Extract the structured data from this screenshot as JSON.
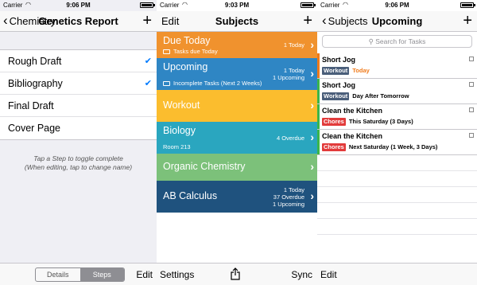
{
  "panel1": {
    "status": {
      "carrier": "Carrier",
      "time": "9:06 PM"
    },
    "back_label": "Chemistry",
    "title": "Genetics Report",
    "plus": "+",
    "steps": [
      {
        "label": "Rough Draft",
        "checked": true
      },
      {
        "label": "Bibliography",
        "checked": true
      },
      {
        "label": "Final Draft",
        "checked": false
      },
      {
        "label": "Cover Page",
        "checked": false
      }
    ],
    "check_glyph": "✔",
    "hint_line1": "Tap a Step to toggle complete",
    "hint_line2": "(When editing, tap to change name)",
    "segments": {
      "details": "Details",
      "steps": "Steps",
      "selected": "Steps"
    },
    "edit": "Edit"
  },
  "panel2": {
    "status": {
      "carrier": "Carrier",
      "time": "9:03 PM"
    },
    "edit": "Edit",
    "title": "Subjects",
    "plus": "+",
    "subjects": [
      {
        "name": "Due Today",
        "sub": "Tasks due Today",
        "meta": [
          "1 Today"
        ],
        "color": "#f0922e",
        "folder": true
      },
      {
        "name": "Upcoming",
        "sub": "Incomplete Tasks (Next 2 Weeks)",
        "meta": [
          "1 Today",
          "1 Upcoming"
        ],
        "color": "#2f86c4",
        "folder": true
      },
      {
        "name": "Workout",
        "sub": "",
        "meta": [],
        "color": "#fbbd2e",
        "folder": false
      },
      {
        "name": "Biology",
        "sub": "Room 213",
        "meta": [
          "4 Overdue"
        ],
        "color": "#2aa6bf",
        "folder": false
      },
      {
        "name": "Organic Chemistry",
        "sub": "",
        "meta": [],
        "color": "#7cc17a",
        "folder": false
      },
      {
        "name": "AB Calculus",
        "sub": "",
        "meta": [
          "1 Today",
          "37 Overdue",
          "1 Upcoming"
        ],
        "color": "#1f527e",
        "folder": false
      }
    ],
    "toolbar": {
      "settings": "Settings",
      "sync": "Sync"
    }
  },
  "panel3": {
    "status": {
      "carrier": "Carrier",
      "time": "9:06 PM"
    },
    "back_label": "Subjects",
    "title": "Upcoming",
    "plus": "+",
    "search_placeholder": "Search for Tasks",
    "tasks": [
      {
        "name": "Short Jog",
        "badge": "Workout",
        "badge_color": "#4a5e7a",
        "due": "Today",
        "due_color": "#f07a1a",
        "bar_color": "#f07a1a"
      },
      {
        "name": "Short Jog",
        "badge": "Workout",
        "badge_color": "#4a5e7a",
        "due": "Day After Tomorrow",
        "due_color": "#000000",
        "bar_color": "#3bb54a"
      },
      {
        "name": "Clean the Kitchen",
        "badge": "Chores",
        "badge_color": "#e23b3b",
        "due": "This Saturday (3 Days)",
        "due_color": "#000000",
        "bar_color": "#3bb54a"
      },
      {
        "name": "Clean the Kitchen",
        "badge": "Chores",
        "badge_color": "#e23b3b",
        "due": "Next Saturday (1 Week, 3 Days)",
        "due_color": "#000000",
        "bar_color": "#3bb54a"
      }
    ],
    "edit": "Edit"
  },
  "colors": {
    "accent": "#007aff"
  }
}
